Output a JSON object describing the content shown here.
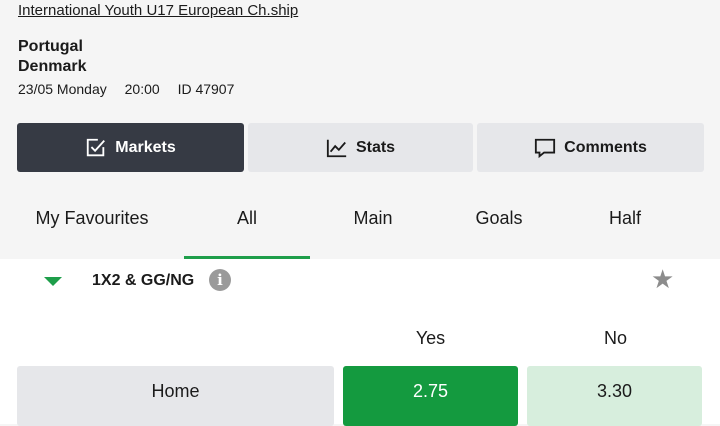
{
  "header": {
    "league": "International Youth U17 European Ch.ship",
    "home_team": "Portugal",
    "away_team": "Denmark",
    "date": "23/05 Monday",
    "time": "20:00",
    "match_id": "ID 47907"
  },
  "main_tabs": [
    {
      "label": "Markets",
      "icon": "checkbox-icon",
      "active": true
    },
    {
      "label": "Stats",
      "icon": "line-chart-icon",
      "active": false
    },
    {
      "label": "Comments",
      "icon": "comment-icon",
      "active": false
    }
  ],
  "sub_tabs": [
    {
      "label": "My Favourites",
      "active": false
    },
    {
      "label": "All",
      "active": true
    },
    {
      "label": "Main",
      "active": false
    },
    {
      "label": "Goals",
      "active": false
    },
    {
      "label": "Half",
      "active": false
    }
  ],
  "market": {
    "title": "1X2 & GG/NG",
    "columns": [
      "Yes",
      "No"
    ],
    "rows": [
      {
        "label": "Home",
        "yes": "2.75",
        "no": "3.30",
        "yes_selected": true
      }
    ]
  },
  "colors": {
    "accent": "#1e9e4a",
    "selected_odd": "#149a3f",
    "unselected_odd": "#d7eedd",
    "active_tab": "#363a44"
  }
}
